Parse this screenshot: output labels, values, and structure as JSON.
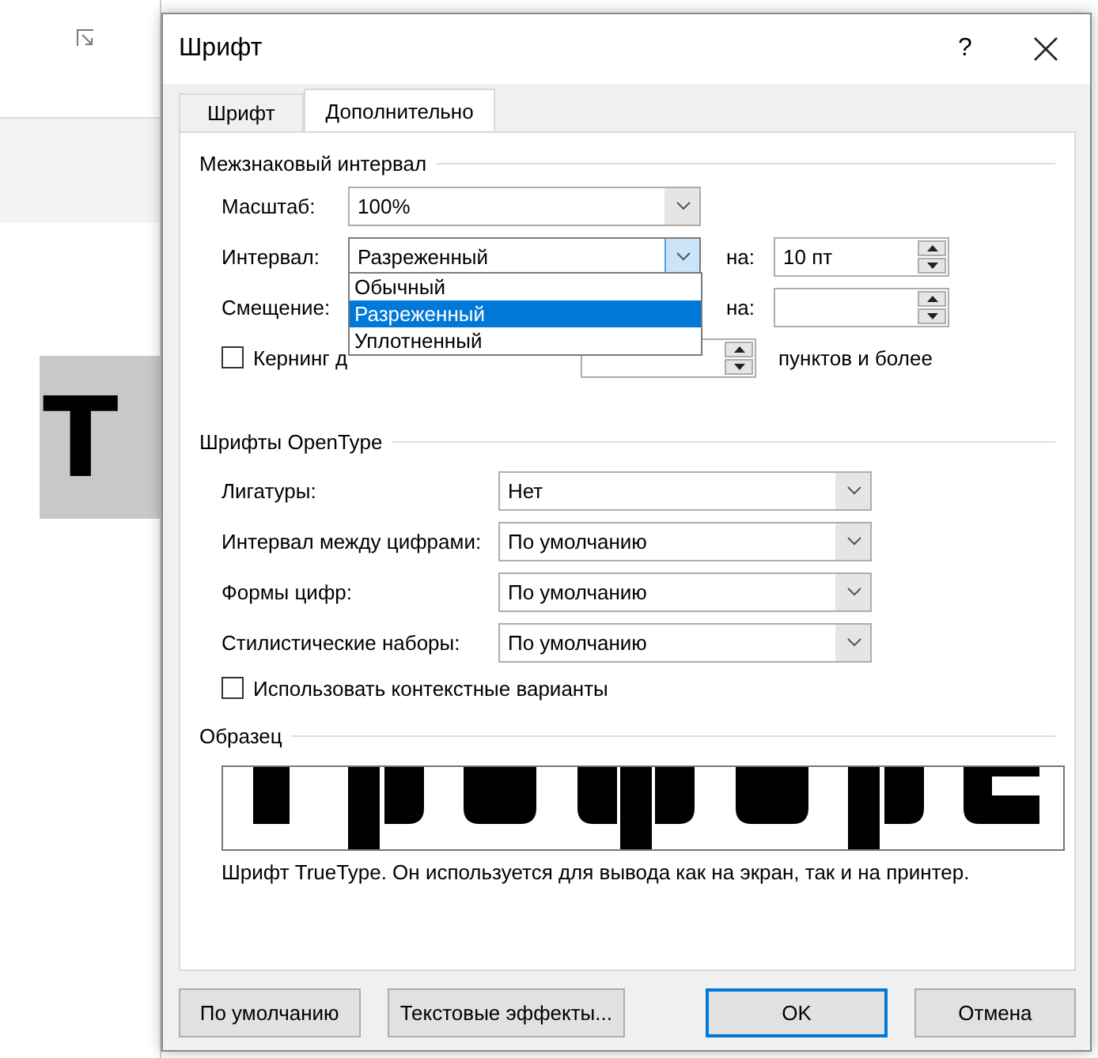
{
  "background": {
    "selection_text": "Т"
  },
  "dialog": {
    "title": "Шрифт",
    "help": "?",
    "tabs": [
      {
        "label": "Шрифт",
        "selected": false
      },
      {
        "label": "Дополнительно",
        "selected": true
      }
    ],
    "character_spacing": {
      "heading": "Межзнаковый интервал",
      "scale": {
        "label": "Масштаб:",
        "value": "100%"
      },
      "spacing": {
        "label": "Интервал:",
        "value": "Разреженный",
        "expanded": true,
        "by_label": "на:",
        "by_value": "10 пт"
      },
      "position": {
        "label": "Смещение:",
        "by_label": "на:"
      },
      "options": [
        {
          "label": "Обычный",
          "selected": false
        },
        {
          "label": "Разреженный",
          "selected": true
        },
        {
          "label": "Уплотненный",
          "selected": false
        }
      ],
      "kerning": {
        "label": "Кернинг д",
        "checked": false,
        "suffix": "пунктов и более"
      }
    },
    "opentype": {
      "heading": "Шрифты OpenType",
      "rows": [
        {
          "label": "Лигатуры:",
          "value": "Нет"
        },
        {
          "label": "Интервал между цифрами:",
          "value": "По умолчанию"
        },
        {
          "label": "Формы цифр:",
          "value": "По умолчанию"
        },
        {
          "label": "Стилистические наборы:",
          "value": "По умолчанию"
        }
      ],
      "contextual": {
        "label": "Использовать контекстные варианты",
        "checked": false
      }
    },
    "preview": {
      "heading": "Образец",
      "note": "Шрифт TrueType. Он используется для вывода как на экран, так и на принтер."
    },
    "buttons": [
      {
        "label": "По умолчанию",
        "default": false
      },
      {
        "label": "Текстовые эффекты...",
        "default": false
      },
      {
        "label": "OK",
        "default": true
      },
      {
        "label": "Отмена",
        "default": false
      }
    ]
  }
}
